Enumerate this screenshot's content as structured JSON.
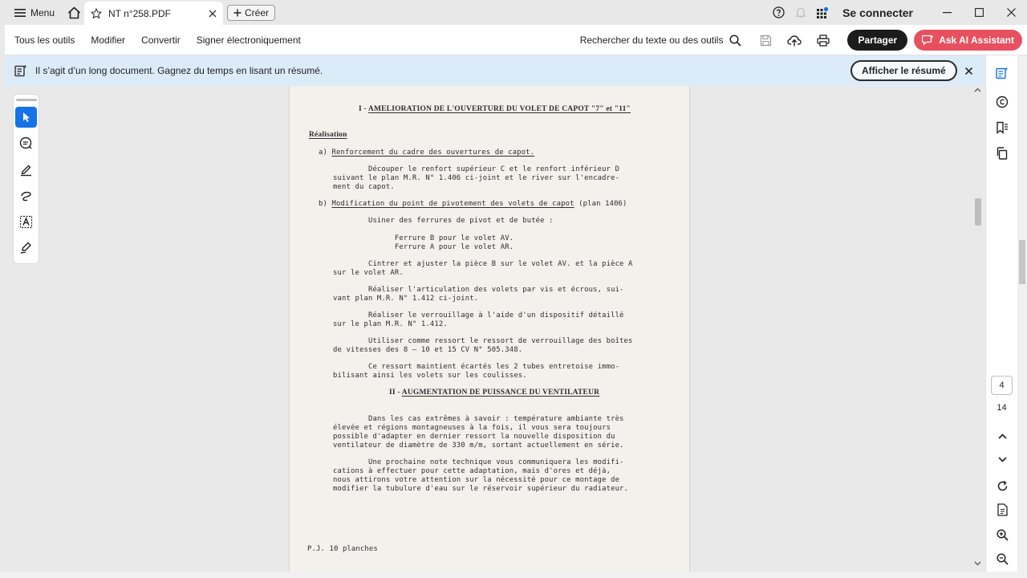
{
  "titlebar": {
    "menu_label": "Menu",
    "tab_title": "NT n°258.PDF",
    "create_label": "Créer",
    "signin_label": "Se connecter"
  },
  "toolbar": {
    "items": [
      "Tous les outils",
      "Modifier",
      "Convertir",
      "Signer électroniquement"
    ],
    "search_label": "Rechercher du texte ou des outils",
    "share_label": "Partager",
    "ai_label": "Ask AI Assistant"
  },
  "banner": {
    "message": "Il s’agit d’un long document. Gagnez du temps en lisant un résumé.",
    "button_label": "Afficher le résumé"
  },
  "document": {
    "heading1_prefix": "I - ",
    "heading1": "AMELIORATION DE L'OUVERTURE DU VOLET DE CAPOT \"7\" et \"11\"",
    "realisation": "Réalisation",
    "a_prefix": "a) ",
    "a_title": "Renforcement du cadre des ouvertures de capot.",
    "p1": [
      "        Découper le renfort supérieur C et le renfort inférieur D",
      "suivant le plan M.R. N° 1.406 ci-joint et le river sur l'encadre-",
      "ment du capot."
    ],
    "b_prefix": "b) ",
    "b_title": "Modification du point de pivotement des volets de capot",
    "b_suffix": " (plan 1406)",
    "p2": "        Usiner des ferrures de pivot et de butée :",
    "p3": [
      "              Ferrure B pour le volet AV.",
      "              Ferrure A pour le volet AR."
    ],
    "p4": [
      "        Cintrer et ajuster la pièce B sur le volet AV. et la pièce A",
      "sur le volet AR."
    ],
    "p5": [
      "        Réaliser l'articulation des volets par vis et écrous, sui-",
      "vant plan M.R. N° 1.412 ci-joint."
    ],
    "p6": [
      "        Réaliser le verrouillage à l'aide d'un dispositif détaillé",
      "sur le plan M.R. N° 1.412."
    ],
    "p7": [
      "        Utiliser comme ressort le ressort de verrouillage des boîtes",
      "de vitesses des 8 — 10 et 15 CV N° 505.348."
    ],
    "p8": [
      "        Ce ressort maintient écartés les 2 tubes entretoise immo-",
      "bilisant ainsi les volets sur les coulisses."
    ],
    "heading2_prefix": "II - ",
    "heading2": "AUGMENTATION DE PUISSANCE DU VENTILATEUR",
    "p9": [
      "        Dans les cas extrêmes à savoir : température ambiante très",
      "élevée et régions montagneuses à la fois, il vous sera toujours",
      "possible d'adapter en dernier ressort la nouvelle disposition du",
      "ventilateur de diamètre de 330 m/m, sortant actuellement en série."
    ],
    "p10": [
      "        Une prochaine note technique vous communiquera les modifi-",
      "cations à effectuer pour cette adaptation, mais d'ores et déjà,",
      "nous attirons votre attention sur la nécessité pour ce montage de",
      "modifier la tubulure d'eau sur le réservoir supérieur du radiateur."
    ],
    "pj": "P.J. 10 planches"
  },
  "navigation": {
    "current_page": "4",
    "total_pages": "14"
  },
  "colors": {
    "accent_blue": "#1473e6",
    "banner_bg": "#dcebf8",
    "ai_button": "#e7505f",
    "share_button": "#1c1c1c"
  }
}
